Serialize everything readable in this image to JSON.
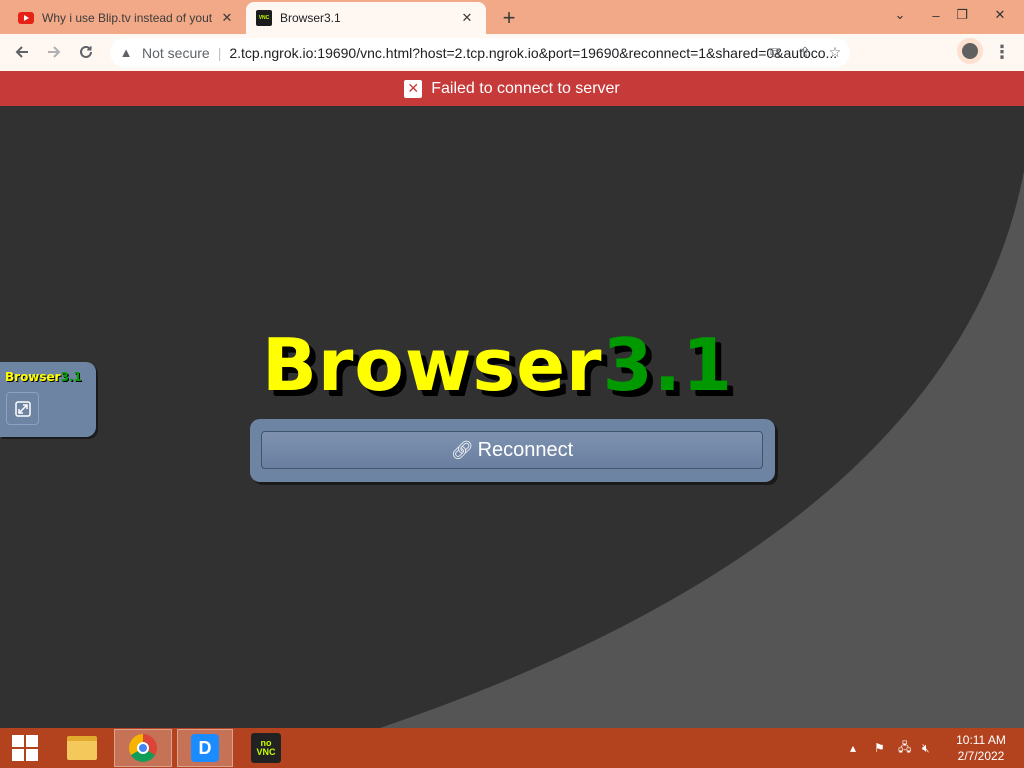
{
  "browser": {
    "tabs": [
      {
        "title": "Why i use Blip.tv instead of yout",
        "icon": "youtube-icon",
        "active": false
      },
      {
        "title": "Browser3.1",
        "icon": "vnc-icon",
        "active": true
      }
    ],
    "new_tab": "+",
    "window_controls": {
      "collapse": "⌄",
      "minimize": "–",
      "restore": "❐",
      "close": "✕"
    },
    "address": {
      "security_label": "Not secure",
      "url": "2.tcp.ngrok.io:19690/vnc.html?host=2.tcp.ngrok.io&port=19690&reconnect=1&shared=0&autoco..."
    }
  },
  "page": {
    "error_message": "Failed to connect to server",
    "logo": {
      "main": "Browser",
      "version": "3.1"
    },
    "reconnect_label": "Reconnect",
    "control_bar": {
      "logo_main": "Browser",
      "logo_version": "3.1"
    }
  },
  "taskbar": {
    "clock": {
      "time": "10:11 AM",
      "date": "2/7/2022"
    },
    "apps": [
      "start-button",
      "file-explorer",
      "chrome",
      "d-app",
      "novnc"
    ],
    "novnc_label_top": "no",
    "novnc_label_bottom": "VNC"
  },
  "colors": {
    "error_bar": "#c63a3a",
    "logo_main": "#ffff00",
    "logo_version": "#009900",
    "panel": "#6e84a3",
    "taskbar": "#b3431f",
    "tabstrip": "#f2a987"
  }
}
